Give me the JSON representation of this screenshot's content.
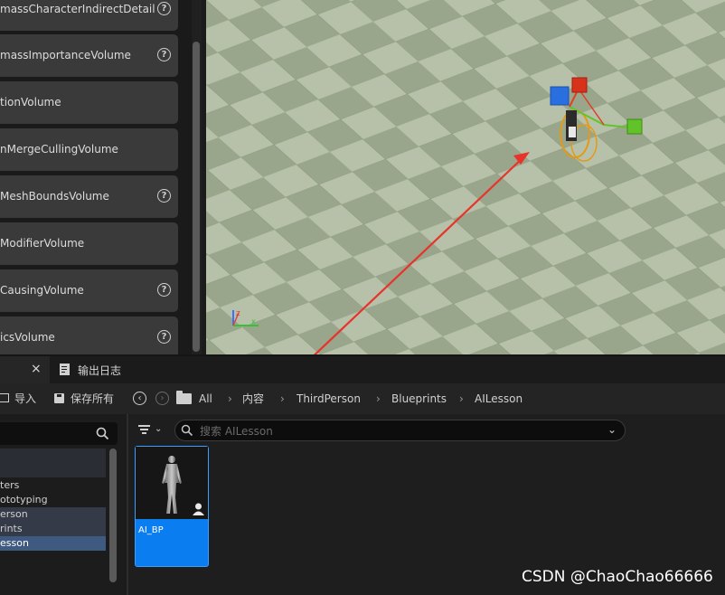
{
  "place_panel": {
    "items": [
      {
        "label": "massCharacterIndirectDetail",
        "help": true
      },
      {
        "label": "massImportanceVolume",
        "help": true
      },
      {
        "label": "tionVolume",
        "help": false
      },
      {
        "label": "nMergeCullingVolume",
        "help": false
      },
      {
        "label": "MeshBoundsVolume",
        "help": true
      },
      {
        "label": "ModifierVolume",
        "help": false
      },
      {
        "label": "CausingVolume",
        "help": true
      },
      {
        "label": "icsVolume",
        "help": true
      }
    ],
    "help_glyph": "?"
  },
  "viewport": {
    "axis_labels": {
      "x": "x",
      "z": "z"
    },
    "colors": {
      "arrow": "#e8322a",
      "floor_light": "#b7c1a9",
      "floor_dark": "#99a68c"
    }
  },
  "tabs": {
    "close_glyph": "×",
    "output_log_label": "输出日志"
  },
  "toolbar": {
    "import_label": "导入",
    "save_all_label": "保存所有",
    "breadcrumbs": [
      "All",
      "内容",
      "ThirdPerson",
      "Blueprints",
      "AILesson"
    ]
  },
  "tree": {
    "items": [
      {
        "label": "ters",
        "selected": false
      },
      {
        "label": "ototyping",
        "selected": false
      },
      {
        "label": "erson",
        "selected": false
      },
      {
        "label": "rints",
        "selected": false
      },
      {
        "label": "esson",
        "selected": true
      }
    ]
  },
  "asset_browser": {
    "search_placeholder": "搜索 AILesson",
    "assets": [
      {
        "name": "AI_BP"
      }
    ]
  },
  "watermark": "CSDN @ChaoChao66666"
}
